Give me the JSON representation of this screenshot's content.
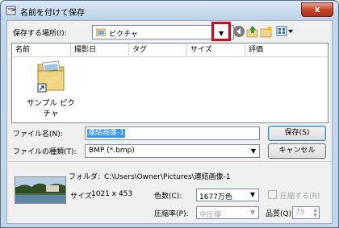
{
  "window": {
    "title": "名前を付けて保存",
    "close_label": "x"
  },
  "location": {
    "label": "保存する場所(I):",
    "value": "ピクチャ",
    "dropdown_arrow": "▼"
  },
  "toolbar_icons": [
    "back-icon",
    "up-folder-icon",
    "new-folder-icon",
    "view-menu-icon"
  ],
  "list": {
    "columns": [
      "名前",
      "撮影日",
      "タグ",
      "サイズ",
      "評価"
    ],
    "items": [
      {
        "label": "サンプル ピクチャ",
        "icon": "folder-shortcut-icon"
      }
    ]
  },
  "filename": {
    "label": "ファイル名(N):",
    "value": "連結画像-1"
  },
  "filetype": {
    "label": "ファイルの種類(T):",
    "value": "BMP (*.bmp)",
    "arrow": "▼"
  },
  "buttons": {
    "save": "保存(S)",
    "cancel": "キャンセル"
  },
  "details": {
    "folder_label": "フォルダ:",
    "folder_value": "C:\\Users\\Owner\\Pictures\\連結画像-1",
    "size_label": "サイズ:",
    "size_value": "1021 x 453",
    "colors_label": "色数(C):",
    "colors_value": "1677万色",
    "compress_label": "圧縮する(R)",
    "ratio_label": "圧縮率(P):",
    "ratio_value": "中圧縮",
    "quality_label": "品質(Q):",
    "quality_value": "75"
  }
}
